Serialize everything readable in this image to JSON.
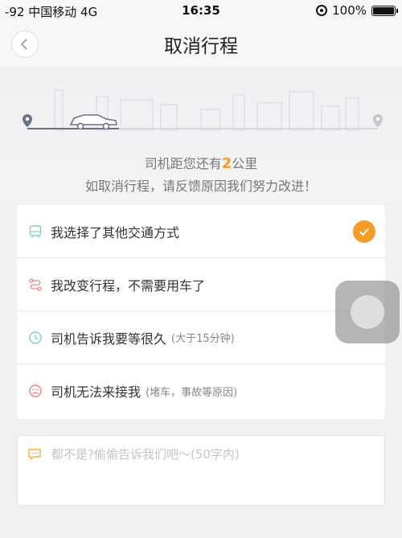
{
  "status_bar": {
    "carrier": "-92 中国移动  4G",
    "time": "16:35",
    "battery": "100%"
  },
  "nav": {
    "title": "取消行程"
  },
  "hero": {
    "distance_prefix": "司机距您还有",
    "distance_value": "2",
    "distance_suffix": "公里",
    "hint": "如取消行程，请反馈原因我们努力改进！"
  },
  "reasons": [
    {
      "label": "我选择了其他交通方式",
      "sub": "",
      "icon": "bus-icon",
      "selected": true
    },
    {
      "label": "我改变行程，不需要用车了",
      "sub": "",
      "icon": "route-icon",
      "selected": false
    },
    {
      "label": "司机告诉我要等很久",
      "sub": "(大于15分钟)",
      "icon": "clock-icon",
      "selected": false
    },
    {
      "label": "司机无法来接我",
      "sub": "(堵车，事故等原因)",
      "icon": "sad-face-icon",
      "selected": false
    }
  ],
  "feedback": {
    "placeholder": "都不是?偷偷告诉我们吧～(50字内)"
  },
  "colors": {
    "accent": "#f39c27",
    "bus_icon": "#7fd1b9",
    "route_icon": "#f08080",
    "clock_icon": "#7fd1b9",
    "sad_icon": "#f08080",
    "feedback_icon": "#f3b23a"
  }
}
